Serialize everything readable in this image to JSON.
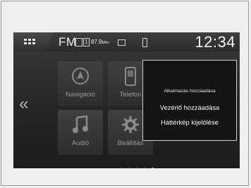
{
  "status_bar": {
    "band": "FM",
    "preset_badge": "1",
    "frequency": "87.9",
    "frequency_unit": "MHz",
    "clock": "12:34"
  },
  "navigation": {
    "back_glyph": "«"
  },
  "apps": [
    {
      "label": "Navigáció",
      "icon": "navigation-icon"
    },
    {
      "label": "Telefon",
      "icon": "phone-icon"
    },
    {
      "label": "Audió",
      "icon": "music-note-icon"
    },
    {
      "label": "Beállítás",
      "icon": "gear-icon"
    }
  ],
  "page_dots": {
    "count": 5,
    "active_index": 4
  },
  "popup": {
    "title": "Alkalmazás hozzáadása",
    "items": [
      {
        "label": "Vezérlő hozzáadása"
      },
      {
        "label": "Háttérkép kijelölése"
      }
    ]
  },
  "colors": {
    "screen_bg": "#262626",
    "text": "#f4f4f4",
    "popup_border": "#cfcfcf"
  }
}
